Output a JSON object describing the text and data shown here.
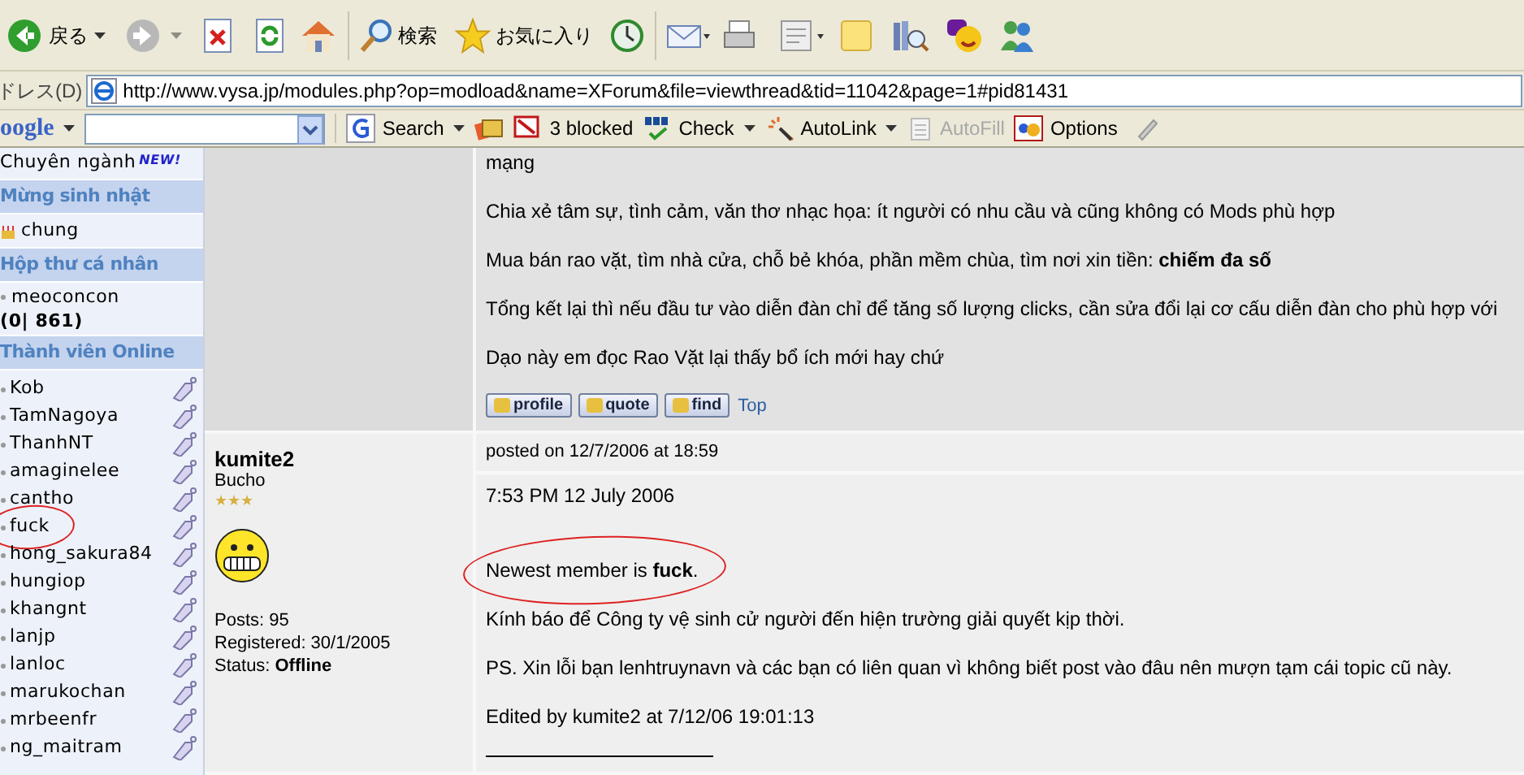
{
  "toolbar": {
    "back": "戻る",
    "search": "検索",
    "favorites": "お気に入り"
  },
  "address_bar": {
    "label": "ドレス(D)",
    "url": "http://www.vysa.jp/modules.php?op=modload&name=XForum&file=viewthread&tid=11042&page=1#pid81431"
  },
  "google_bar": {
    "logo": "oogle",
    "buttons": [
      {
        "kind": "search",
        "label": "Search",
        "disabled": false
      },
      {
        "kind": "blocked",
        "label": "3 blocked",
        "disabled": false
      },
      {
        "kind": "check",
        "label": "Check",
        "disabled": false
      },
      {
        "kind": "autolink",
        "label": "AutoLink",
        "disabled": false
      },
      {
        "kind": "autofill",
        "label": "AutoFill",
        "disabled": true
      },
      {
        "kind": "options",
        "label": "Options",
        "disabled": false
      }
    ]
  },
  "sidebar": {
    "top_item": {
      "label": "Chuyên ngành",
      "badge": "NEW!"
    },
    "birthday": {
      "title": "Mừng sinh nhật",
      "member": "chung"
    },
    "inbox": {
      "title": "Hộp thư cá nhân",
      "user": "meoconcon",
      "count": "(0| 861)"
    },
    "online": {
      "title": "Thành viên Online",
      "members": [
        {
          "name": "Kob",
          "circled": false
        },
        {
          "name": "TamNagoya",
          "circled": false
        },
        {
          "name": "ThanhNT",
          "circled": false
        },
        {
          "name": "amaginelee",
          "circled": false
        },
        {
          "name": "cantho",
          "circled": false
        },
        {
          "name": "fuck",
          "circled": true
        },
        {
          "name": "hong_sakura84",
          "circled": false
        },
        {
          "name": "hungiop",
          "circled": false
        },
        {
          "name": "khangnt",
          "circled": false
        },
        {
          "name": "lanjp",
          "circled": false
        },
        {
          "name": "lanloc",
          "circled": false
        },
        {
          "name": "marukochan",
          "circled": false
        },
        {
          "name": "mrbeenfr",
          "circled": false
        },
        {
          "name": "ng_maitram",
          "circled": false
        }
      ]
    }
  },
  "posts": [
    {
      "paragraphs": [
        {
          "text": "mạng",
          "circled": false
        },
        {
          "text": "Chia xẻ tâm sự, tình cảm, văn thơ nhạc họa: ít người có nhu cầu và cũng không có Mods phù hợp",
          "circled": false
        },
        {
          "text": "Mua bán rao vặt, tìm nhà cửa, chỗ bẻ khóa, phần mềm chùa, tìm nơi xin tiền: **chiếm đa số**",
          "circled": false
        },
        {
          "text": "Tổng kết lại thì nếu đầu tư vào diễn đàn chỉ để tăng số lượng clicks, cần sửa đổi lại cơ cấu diễn đàn cho phù hợp với",
          "circled": false
        },
        {
          "text": "Dạo này em đọc Rao Vặt lại thấy bổ ích mới hay chứ",
          "circled": false
        }
      ],
      "actions": [
        "profile",
        "quote",
        "find"
      ],
      "top_link": "Top"
    },
    {
      "author": "kumite2",
      "rank": "Bucho",
      "stars": 3,
      "posts": "Posts: 95",
      "registered": "Registered: 30/1/2005",
      "status_label": "Status:",
      "status": "Offline",
      "posted": "posted on 12/7/2006 at 18:59",
      "paragraphs": [
        {
          "text": "7:53 PM 12 July 2006",
          "circled": false
        },
        {
          "text": "Newest member is **fuck**.",
          "circled": true
        },
        {
          "text": "Kính báo để Công ty vệ sinh cử người đến hiện trường giải quyết kịp thời.",
          "circled": false
        },
        {
          "text": "PS. Xin lỗi bạn lenhtruynavn và các bạn có liên quan vì không biết post vào đâu nên mượn tạm cái topic cũ này.",
          "circled": false
        },
        {
          "text": "Edited by kumite2 at 7/12/06 19:01:13",
          "circled": false
        }
      ]
    }
  ]
}
